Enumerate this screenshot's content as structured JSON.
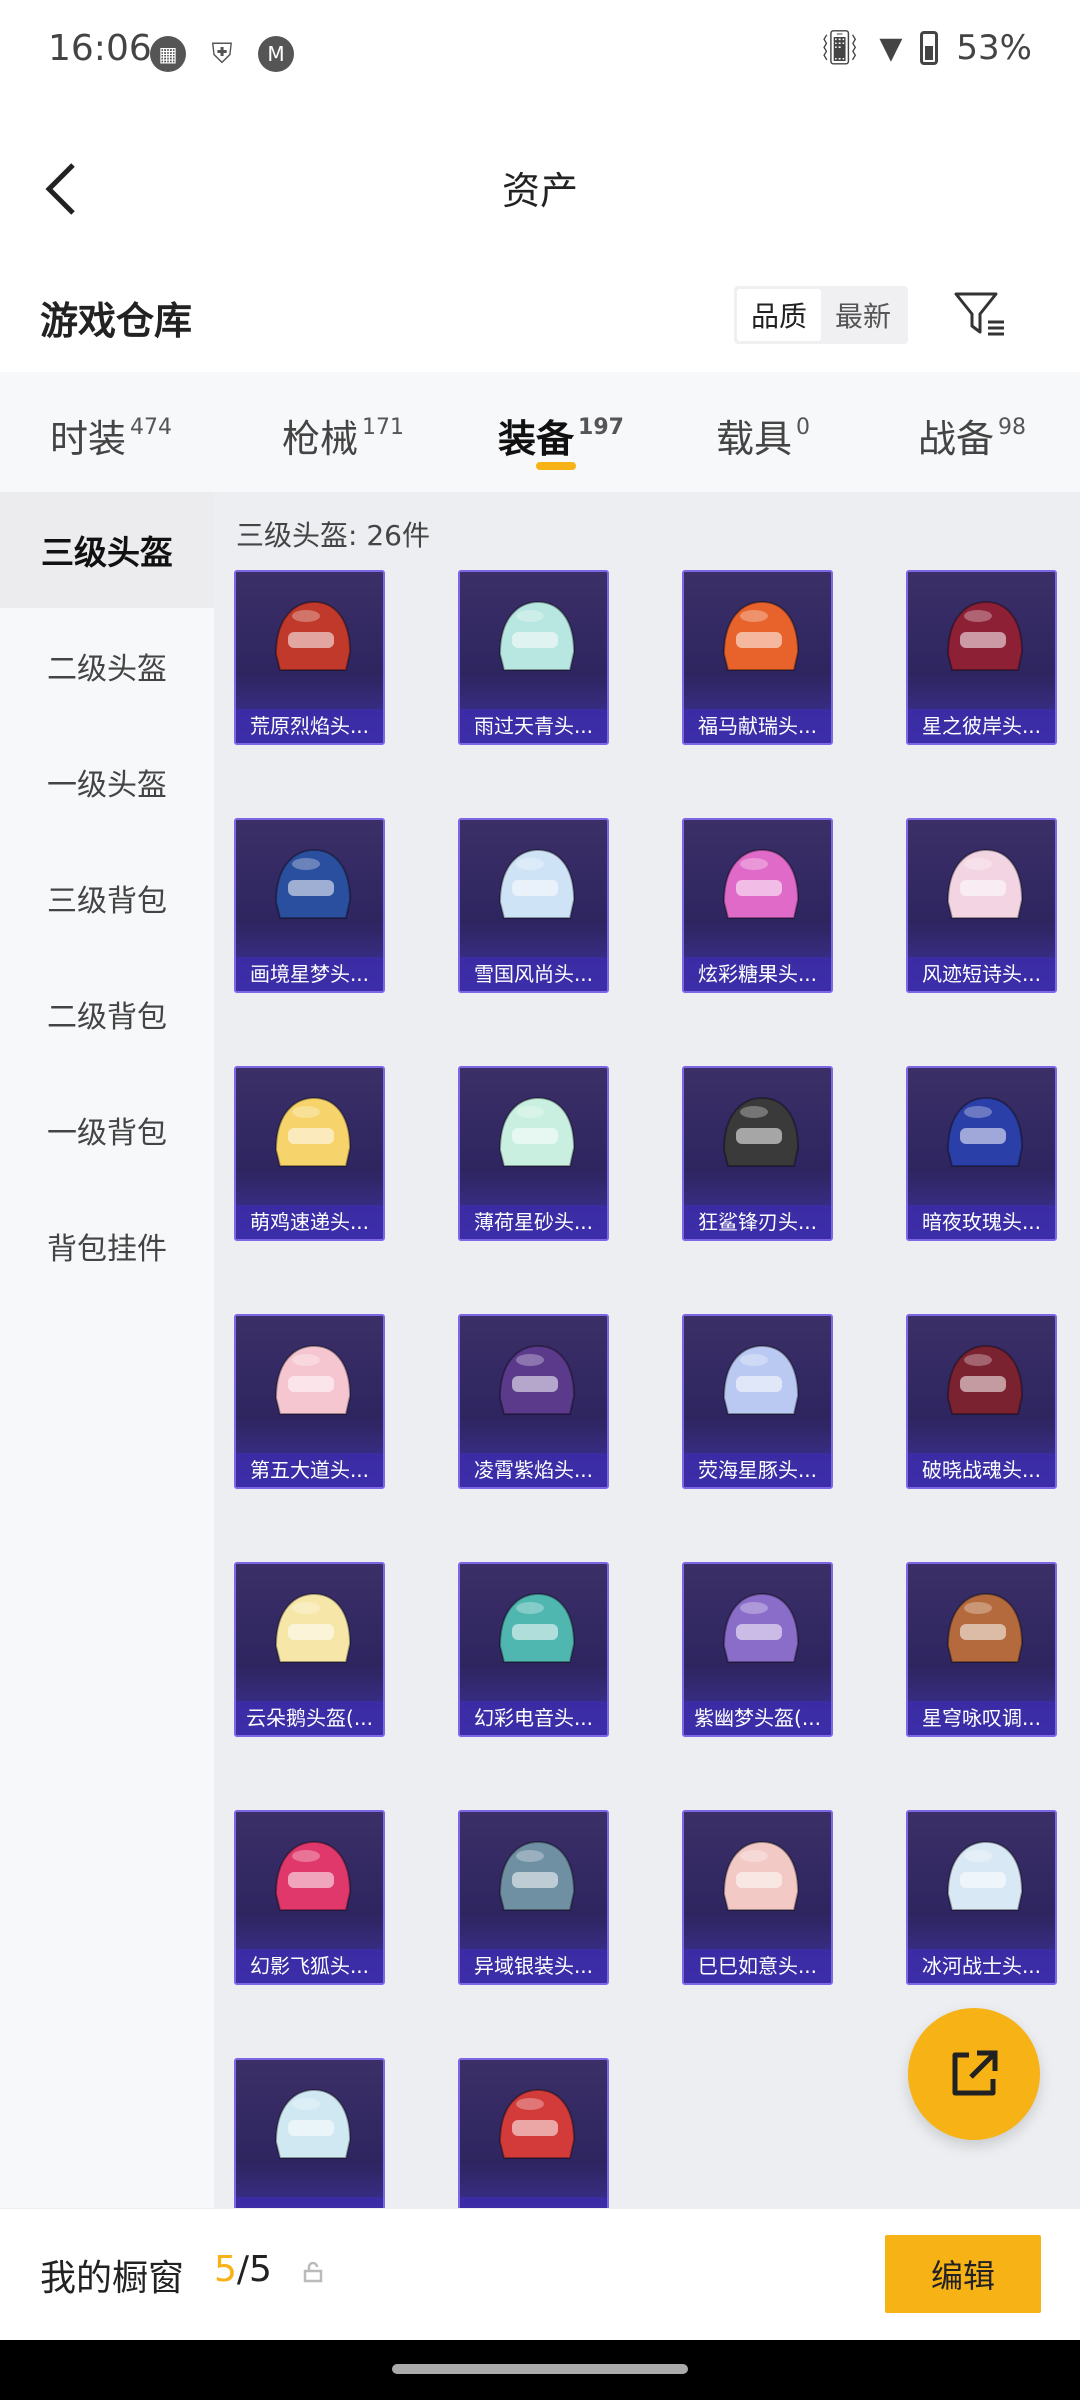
{
  "status": {
    "time": "16:06",
    "battery": "53%"
  },
  "header": {
    "title": "资产"
  },
  "warehouse": {
    "title": "游戏仓库",
    "sort_options": [
      "品质",
      "最新"
    ]
  },
  "tabs": [
    {
      "label": "时装",
      "count": "474"
    },
    {
      "label": "枪械",
      "count": "171"
    },
    {
      "label": "装备",
      "count": "197"
    },
    {
      "label": "载具",
      "count": "0"
    },
    {
      "label": "战备",
      "count": "98"
    }
  ],
  "side_nav": [
    "三级头盔",
    "二级头盔",
    "一级头盔",
    "三级背包",
    "二级背包",
    "一级背包",
    "背包挂件"
  ],
  "section": {
    "label": "三级头盔: 26件"
  },
  "items": [
    {
      "name": "荒原烈焰头...",
      "color": "#c0392b"
    },
    {
      "name": "雨过天青头...",
      "color": "#b8e6e0"
    },
    {
      "name": "福马献瑞头...",
      "color": "#e8632b"
    },
    {
      "name": "星之彼岸头...",
      "color": "#8e2036"
    },
    {
      "name": "画境星梦头...",
      "color": "#2a4f9e"
    },
    {
      "name": "雪国风尚头...",
      "color": "#cfe3f7"
    },
    {
      "name": "炫彩糖果头...",
      "color": "#e06ac8"
    },
    {
      "name": "风迹短诗头...",
      "color": "#f2d4e2"
    },
    {
      "name": "萌鸡速递头...",
      "color": "#f6d36b"
    },
    {
      "name": "薄荷星砂头...",
      "color": "#c8efe0"
    },
    {
      "name": "狂鲨锋刃头...",
      "color": "#3a3a3a"
    },
    {
      "name": "暗夜玫瑰头...",
      "color": "#2b3fa8"
    },
    {
      "name": "第五大道头...",
      "color": "#f5c6d0"
    },
    {
      "name": "凌霄紫焰头...",
      "color": "#5b3a8c"
    },
    {
      "name": "荧海星豚头...",
      "color": "#b9c9f2"
    },
    {
      "name": "破晓战魂头...",
      "color": "#7a2230"
    },
    {
      "name": "云朵鹅头盔(...",
      "color": "#f6e7a8"
    },
    {
      "name": "幻彩电音头...",
      "color": "#4fb6b0"
    },
    {
      "name": "紫幽梦头盔(...",
      "color": "#8a6cc9"
    },
    {
      "name": "星穹咏叹调...",
      "color": "#b46a3c"
    },
    {
      "name": "幻影飞狐头...",
      "color": "#e0386a"
    },
    {
      "name": "异域银装头...",
      "color": "#6f8fa3"
    },
    {
      "name": "巳巳如意头...",
      "color": "#f2c9c4"
    },
    {
      "name": "冰河战士头...",
      "color": "#d9e8f5"
    },
    {
      "name": "",
      "color": "#cfe8f2"
    },
    {
      "name": "",
      "color": "#d33b3b"
    }
  ],
  "showcase": {
    "label": "我的橱窗",
    "current": "5",
    "total": "/5"
  },
  "edit_label": "编辑"
}
